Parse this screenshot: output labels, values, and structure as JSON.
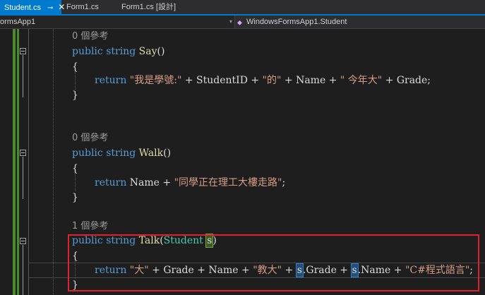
{
  "tabs": [
    {
      "label": "Student.cs",
      "active": true,
      "pin_glyph": "⊸",
      "close_glyph": "✕"
    },
    {
      "label": "Form1.cs",
      "active": false
    },
    {
      "label": "Form1.cs [設計]",
      "active": false
    }
  ],
  "navbar": {
    "project": "ormsApp1",
    "dropdown_glyph": "▾",
    "class_path": "WindowsFormsApp1.Student",
    "class_icon": "class-icon"
  },
  "code": {
    "say": {
      "lens": "0 個參考",
      "kw_public": "public",
      "kw_string": "string",
      "name": "Say",
      "params": "()",
      "open": "{",
      "close": "}",
      "return_kw": "return",
      "s1": "\"我是學號:\"",
      "op1": " + StudentID + ",
      "s2": "\"的\"",
      "op2": " + Name + ",
      "s3": "\" 今年大\"",
      "op3": " + Grade;"
    },
    "walk": {
      "lens": "0 個參考",
      "kw_public": "public",
      "kw_string": "string",
      "name": "Walk",
      "params": "()",
      "open": "{",
      "close": "}",
      "return_kw": "return",
      "op1": " Name + ",
      "s1": "\"同學正在理工大樓走路\"",
      "end": ";"
    },
    "talk": {
      "lens": "1 個參考",
      "kw_public": "public",
      "kw_string": "string",
      "name": "Talk",
      "paren_open": "(",
      "param_type": "Student",
      "param_name": "s",
      "paren_close": ")",
      "open": "{",
      "close": "}",
      "return_kw": "return",
      "s1": "\"大\"",
      "op1": " + Grade + Name + ",
      "s2": "\"教大\"",
      "op2": " + ",
      "ref1": "s",
      "op3": ".Grade + ",
      "ref2": "s",
      "op4": ".Name + ",
      "s3": "\"C#程式語言\"",
      "end": ";"
    }
  },
  "colors": {
    "keyword": "#569cd6",
    "type": "#4ec9b0",
    "method": "#dcdcaa",
    "string": "#d69d85",
    "annotation_red": "#e0202a",
    "tab_active": "#007acc"
  }
}
